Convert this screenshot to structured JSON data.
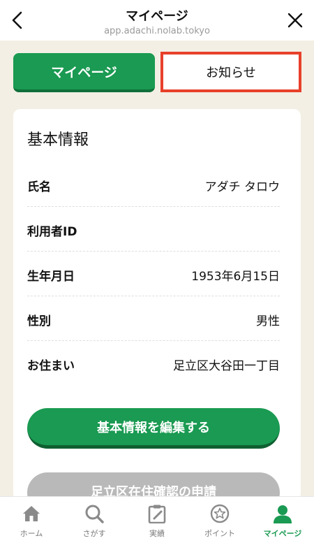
{
  "header": {
    "title": "マイページ",
    "url": "app.adachi.nolab.tokyo"
  },
  "tabs": {
    "mypage": "マイページ",
    "news": "お知らせ"
  },
  "basic_info": {
    "title": "基本情報",
    "rows": [
      {
        "label": "氏名",
        "value": "アダチ タロウ"
      },
      {
        "label": "利用者ID",
        "value": ""
      },
      {
        "label": "生年月日",
        "value": "1953年6月15日"
      },
      {
        "label": "性別",
        "value": "男性"
      },
      {
        "label": "お住まい",
        "value": "足立区大谷田一丁目"
      }
    ],
    "edit_button": "基本情報を編集する",
    "apply_button": "足立区在住確認の申請"
  },
  "bottom_nav": [
    {
      "label": "ホーム",
      "icon": "home-icon"
    },
    {
      "label": "さがす",
      "icon": "search-icon"
    },
    {
      "label": "実績",
      "icon": "clipboard-icon"
    },
    {
      "label": "ポイント",
      "icon": "point-icon"
    },
    {
      "label": "マイページ",
      "icon": "user-icon"
    }
  ],
  "colors": {
    "primary": "#1a9a52",
    "highlight": "#e8402a",
    "background": "#f3efe4"
  }
}
